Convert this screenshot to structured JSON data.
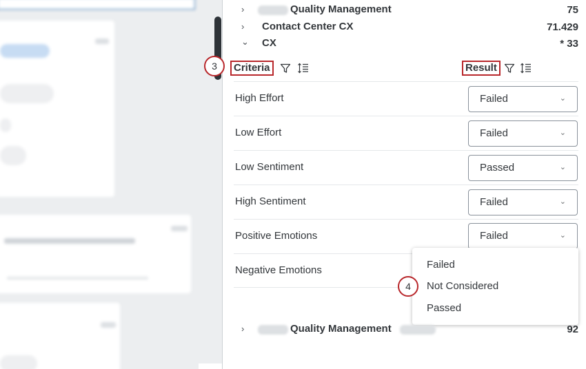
{
  "groups_top": [
    {
      "label": "Quality Management",
      "score": "75",
      "chevron": "›"
    },
    {
      "label": "Contact Center CX",
      "score": "71.429",
      "chevron": "›"
    },
    {
      "label": "CX",
      "score": "* 33",
      "chevron": "⌄"
    }
  ],
  "columns": {
    "criteria_label": "Criteria",
    "result_label": "Result"
  },
  "step_markers": {
    "criteria_step": "3",
    "dropdown_step": "4"
  },
  "criteria_rows": [
    {
      "label": "High Effort",
      "result": "Failed"
    },
    {
      "label": "Low Effort",
      "result": "Failed"
    },
    {
      "label": "Low Sentiment",
      "result": "Passed"
    },
    {
      "label": "High Sentiment",
      "result": "Failed"
    },
    {
      "label": "Positive Emotions",
      "result": "Failed"
    },
    {
      "label": "Negative Emotions",
      "result": ""
    }
  ],
  "dropdown": {
    "options": [
      "Failed",
      "Not Considered",
      "Passed"
    ]
  },
  "group_bottom": {
    "label": "Quality Management",
    "score": "92",
    "chevron": "›"
  },
  "colors": {
    "highlight_red": "#b8262a",
    "text": "#32363a",
    "input_border": "#89919a"
  },
  "icons": {
    "filter": "filter-icon",
    "sort": "sort-icon",
    "caret": "caret-down-icon"
  }
}
